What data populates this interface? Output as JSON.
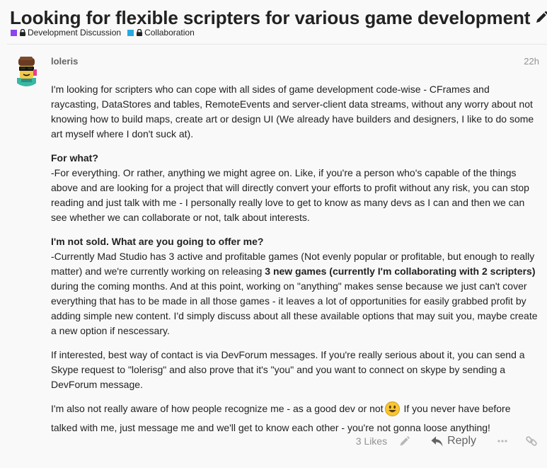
{
  "topic": {
    "title": "Looking for flexible scripters for various game development",
    "categories": [
      {
        "name": "Development Discussion",
        "color": "#8e44ec"
      },
      {
        "name": "Collaboration",
        "color": "#25aae2"
      }
    ]
  },
  "post": {
    "username": "loleris",
    "date": "22h",
    "paragraphs": {
      "p1": "I'm looking for scripters who can cope with all sides of game development code-wise - CFrames and raycasting, DataStores and tables, RemoteEvents and server-client data streams, without any worry about not knowing how to build maps, create art or design UI (We already have builders and designers, I like to do some art myself where I don't suck at).",
      "p2_heading": "For what?",
      "p2_text": "-For everything. Or rather, anything we might agree on. Like, if you're a person who's capable of the things above and are looking for a project that will directly convert your efforts to profit without any risk, you can stop reading and just talk with me - I personally really love to get to know as many devs as I can and then we can see whether we can collaborate or not, talk about interests.",
      "p3_heading": "I'm not sold. What are you going to offer me?",
      "p3_a": "-Currently Mad Studio has 3 active and profitable games (Not evenly popular or profitable, but enough to really matter) and we're currently working on releasing ",
      "p3_bold": "3 new games (currently I'm collaborating with 2 scripters)",
      "p3_b": " during the coming months. And at this point, working on \"anything\" makes sense because we just can't cover everything that has to be made in all those games - it leaves a lot of opportunities for easily grabbed profit by adding simple new content. I'd simply discuss about all these available options that may suit you, maybe create a new option if nescessary.",
      "p4": "If interested, best way of contact is via DevForum messages. If you're really serious about it, you can send a Skype request to \"lolerisg\" and also prove that it's \"you\" and you want to connect on skype by sending a DevForum message.",
      "p5_a": "I'm also not really aware of how people recognize me - as a good dev or not",
      "p5_b": " If you never have before talked with me, just message me and we'll get to know each other - you're not gonna loose anything!"
    },
    "actions": {
      "likes": "3 Likes",
      "reply": "Reply"
    }
  }
}
